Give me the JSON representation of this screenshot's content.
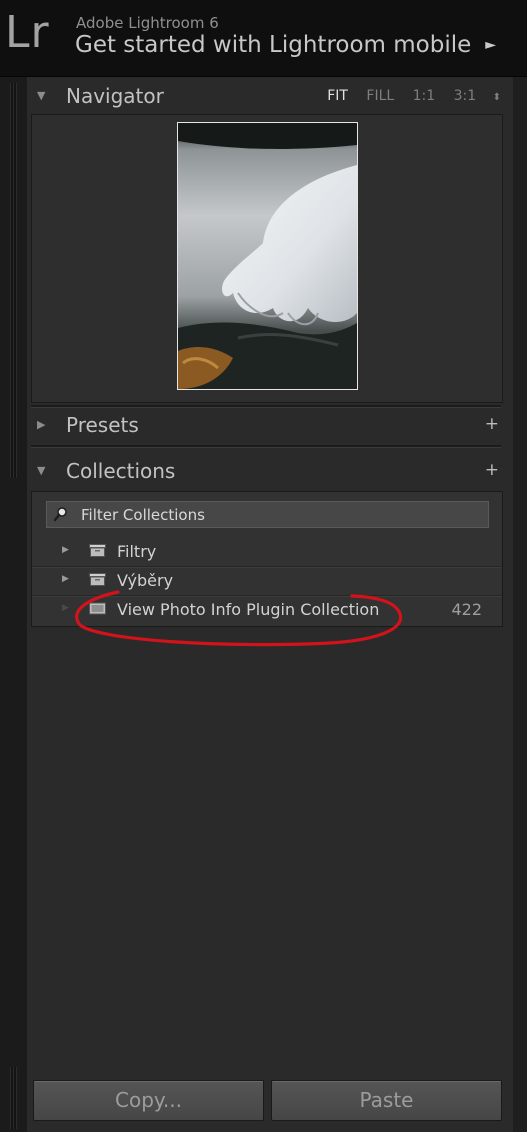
{
  "header": {
    "logo": "Lr",
    "app_name": "Adobe Lightroom 6",
    "mobile_link": "Get started with Lightroom mobile",
    "mobile_arrow": "►"
  },
  "navigator": {
    "title": "Navigator",
    "zoom_options": [
      "FIT",
      "FILL",
      "1:1",
      "3:1"
    ],
    "selected_zoom": "FIT",
    "updown": "⬍"
  },
  "presets": {
    "title": "Presets",
    "add": "+"
  },
  "collections": {
    "title": "Collections",
    "add": "+",
    "filter_placeholder": "Filter Collections",
    "items": [
      {
        "label": "Filtry",
        "count": ""
      },
      {
        "label": "Výběry",
        "count": ""
      },
      {
        "label": "View Photo Info Plugin Collection",
        "count": "422"
      }
    ]
  },
  "buttons": {
    "copy": "Copy...",
    "paste": "Paste"
  },
  "colors": {
    "annotation": "#d2131b",
    "background": "#2a2a2a"
  }
}
